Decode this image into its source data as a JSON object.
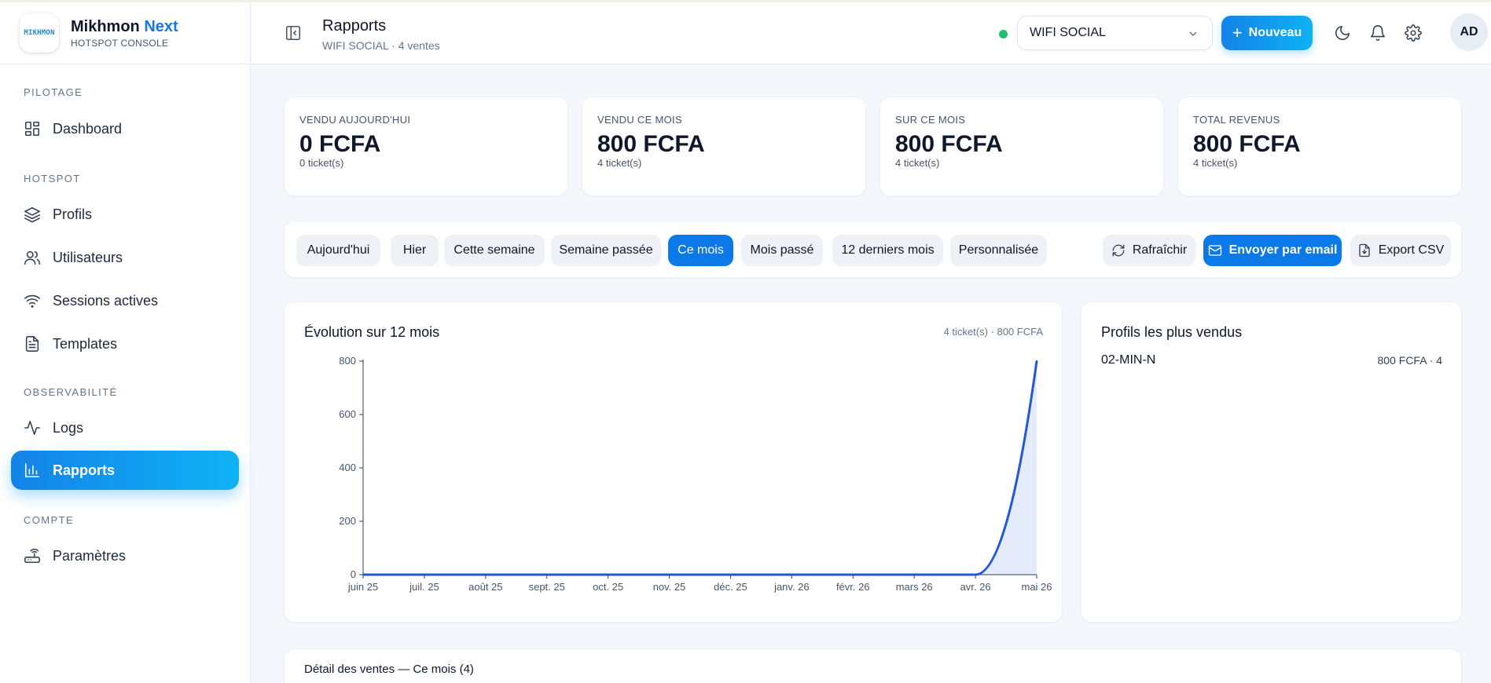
{
  "brand": {
    "logo_text": "MIKHMON",
    "name": "Mikhmon",
    "accent": "Next",
    "subtitle": "HOTSPOT CONSOLE"
  },
  "sidebar": {
    "sections": [
      "PILOTAGE",
      "HOTSPOT",
      "OBSERVABILITÉ",
      "COMPTE"
    ],
    "items": [
      {
        "label": "Dashboard",
        "icon": "dashboard-icon"
      },
      {
        "label": "Profils",
        "icon": "layers-icon"
      },
      {
        "label": "Utilisateurs",
        "icon": "users-icon"
      },
      {
        "label": "Sessions actives",
        "icon": "wifi-icon"
      },
      {
        "label": "Templates",
        "icon": "file-text-icon"
      },
      {
        "label": "Logs",
        "icon": "activity-icon"
      },
      {
        "label": "Rapports",
        "icon": "bar-chart-icon",
        "active": true
      },
      {
        "label": "Paramètres",
        "icon": "router-icon"
      }
    ]
  },
  "header": {
    "title": "Rapports",
    "subtitle": "WIFI SOCIAL · 4 ventes",
    "site_select": "WIFI SOCIAL",
    "new_button": "Nouveau",
    "avatar": "AD",
    "status_color": "#1fbf6e"
  },
  "stats": [
    {
      "label": "VENDU AUJOURD'HUI",
      "value": "0 FCFA",
      "sub": "0 ticket(s)"
    },
    {
      "label": "VENDU CE MOIS",
      "value": "800 FCFA",
      "sub": "4 ticket(s)"
    },
    {
      "label": "SUR CE MOIS",
      "value": "800 FCFA",
      "sub": "4 ticket(s)"
    },
    {
      "label": "TOTAL REVENUS",
      "value": "800 FCFA",
      "sub": "4 ticket(s)"
    }
  ],
  "filters": {
    "periods": [
      "Aujourd'hui",
      "Hier",
      "Cette semaine",
      "Semaine passée",
      "Ce mois",
      "Mois passé",
      "12 derniers mois",
      "Personnalisée"
    ],
    "active_period": "Ce mois",
    "refresh": "Rafraîchir",
    "email": "Envoyer par email",
    "export": "Export CSV"
  },
  "evolution": {
    "title": "Évolution sur 12 mois",
    "meta": "4 ticket(s) · 800 FCFA"
  },
  "chart_data": {
    "type": "area",
    "title": "",
    "xlabel": "",
    "ylabel": "",
    "categories": [
      "juin 25",
      "juil. 25",
      "août 25",
      "sept. 25",
      "oct. 25",
      "nov. 25",
      "déc. 25",
      "janv. 26",
      "févr. 26",
      "mars 26",
      "avr. 26",
      "mai 26"
    ],
    "values": [
      0,
      0,
      0,
      0,
      0,
      0,
      0,
      0,
      0,
      0,
      0,
      800
    ],
    "ylim": [
      0,
      800
    ],
    "yticks": [
      0,
      200,
      400,
      600,
      800
    ],
    "grid": false,
    "line_color": "#2356d8",
    "fill_color": "#e4ebfb"
  },
  "top_profiles": {
    "title": "Profils les plus vendus",
    "items": [
      {
        "name": "02-MIN-N",
        "value": "800 FCFA · 4"
      }
    ]
  },
  "detail": {
    "title": "Détail des ventes — Ce mois (4)"
  },
  "colors": {
    "accent": "#0b7ae8",
    "accent_gradient_end": "#0fb2f4"
  }
}
